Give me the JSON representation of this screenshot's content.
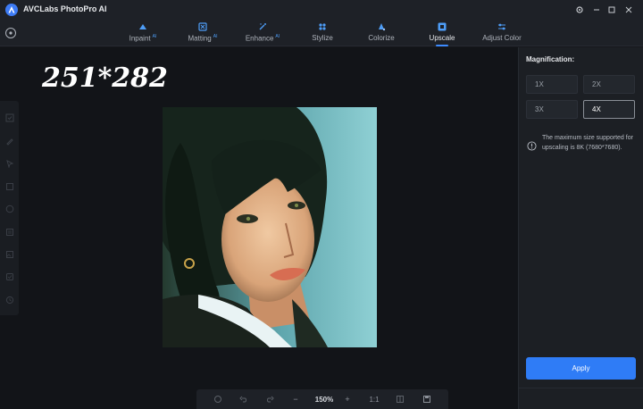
{
  "app": {
    "title": "AVCLabs PhotoPro AI",
    "logo_icon": "avclabs-logo-icon"
  },
  "window_controls": {
    "settings_icon": "gear-icon",
    "minimize_icon": "minimize-icon",
    "maximize_icon": "maximize-icon",
    "close_icon": "close-icon"
  },
  "tabs": [
    {
      "label": "Inpaint",
      "ai": "AI",
      "icon": "inpaint-icon"
    },
    {
      "label": "Matting",
      "ai": "AI",
      "icon": "matting-icon"
    },
    {
      "label": "Enhance",
      "ai": "AI",
      "icon": "enhance-icon"
    },
    {
      "label": "Stylize",
      "ai": "",
      "icon": "stylize-icon"
    },
    {
      "label": "Colorize",
      "ai": "",
      "icon": "colorize-icon"
    },
    {
      "label": "Upscale",
      "ai": "",
      "icon": "upscale-icon",
      "active": true
    },
    {
      "label": "Adjust Color",
      "ai": "",
      "icon": "adjust-color-icon"
    }
  ],
  "canvas": {
    "size_overlay": "251*282"
  },
  "left_tools": [
    "check-icon",
    "pen-icon",
    "pointer-icon",
    "rectangle-icon",
    "ellipse-icon",
    "layers-icon",
    "image-icon",
    "checkbox-icon",
    "history-icon"
  ],
  "bottom_bar": {
    "zoom_value": "150%",
    "minus": "−",
    "plus": "+",
    "ratio": "1:1"
  },
  "panel": {
    "title": "Magnification:",
    "options": [
      "1X",
      "2X",
      "3X",
      "4X"
    ],
    "selected": "4X",
    "info": "The maximum size supported for upscaling is 8K (7680*7680).",
    "apply_label": "Apply"
  },
  "colors": {
    "accent": "#2f7cf6",
    "background": "#15171c",
    "panel": "#1c1f24"
  }
}
